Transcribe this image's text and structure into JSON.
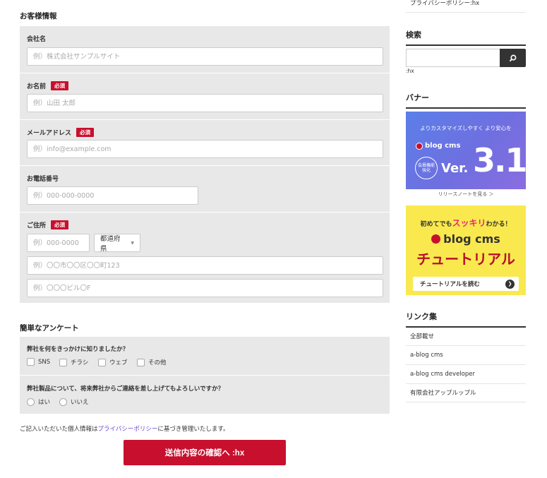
{
  "form": {
    "section_title": "お客様情報",
    "company": {
      "label": "会社名",
      "placeholder": "例）株式会社サンプルサイト"
    },
    "name": {
      "label": "お名前",
      "required": "必須",
      "placeholder": "例）山田 太郎"
    },
    "email": {
      "label": "メールアドレス",
      "required": "必須",
      "placeholder": "例）info@example.com"
    },
    "phone": {
      "label": "お電話番号",
      "placeholder": "例）000-000-0000"
    },
    "address": {
      "label": "ご住所",
      "required": "必須",
      "zip_placeholder": "例）000-0000",
      "prefecture_value": "都道府県",
      "city_placeholder": "例）〇〇市〇〇区〇〇町123",
      "building_placeholder": "例）〇〇〇ビル〇F"
    }
  },
  "survey": {
    "section_title": "簡単なアンケート",
    "q1": {
      "label": "弊社を何をきっかけに知りましたか？",
      "options": [
        "SNS",
        "チラシ",
        "ウェブ",
        "その他"
      ]
    },
    "q2": {
      "label": "弊社製品について、将来弊社からご連絡を差し上げてもよろしいですか？",
      "options": [
        "はい",
        "いいえ"
      ]
    }
  },
  "privacy": {
    "prefix": "ご記入いただいた個人情報は",
    "link": "プライバシーポリシー",
    "suffix": "に基づき管理いたします。"
  },
  "submit_label": "送信内容の確認へ :hx",
  "sidebar": {
    "top_link": "プライバシーポリシー:hx",
    "search_title": "検索",
    "search_note": ":hx",
    "banner_title": "バナー",
    "banner1": {
      "tagline": "よりカスタマイズしやすく より安心を",
      "brand": "blog cms",
      "badge1": "会員機能",
      "badge2": "強化",
      "ver": "Ver.",
      "num": "3.1",
      "caption": "リリースノートを見る ＞"
    },
    "banner2": {
      "top": "初めてでも",
      "highlight": "スッキリ",
      "top_end": "わかる！",
      "brand": "blog cms",
      "title": "チュートリアル",
      "button": "チュートリアルを読む"
    },
    "links_title": "リンク集",
    "links": [
      "全部載せ",
      "a-blog cms",
      "a-blog cms developer",
      "有限会社アップルップル"
    ]
  },
  "colors": {
    "accent": "#c8102e",
    "link": "#6a48d7",
    "panel": "#e8e8e8"
  }
}
